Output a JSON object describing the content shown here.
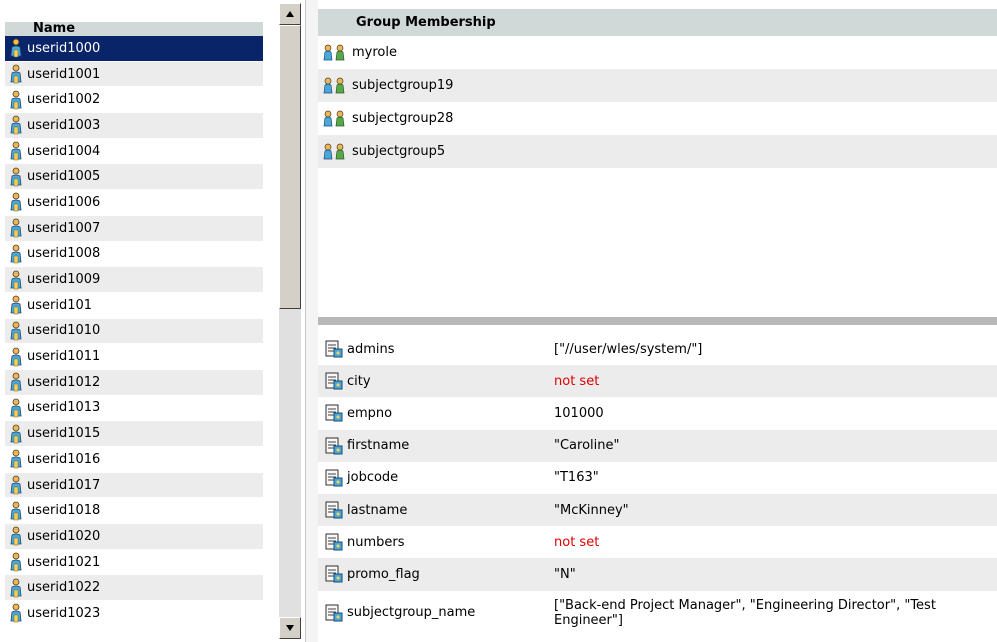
{
  "users": {
    "header": "Name",
    "items": [
      "userid1000",
      "userid1001",
      "userid1002",
      "userid1003",
      "userid1004",
      "userid1005",
      "userid1006",
      "userid1007",
      "userid1008",
      "userid1009",
      "userid101",
      "userid1010",
      "userid1011",
      "userid1012",
      "userid1013",
      "userid1015",
      "userid1016",
      "userid1017",
      "userid1018",
      "userid1020",
      "userid1021",
      "userid1022",
      "userid1023"
    ],
    "selected_index": 0
  },
  "groups": {
    "header": "Group Membership",
    "items": [
      "myrole",
      "subjectgroup19",
      "subjectgroup28",
      "subjectgroup5"
    ]
  },
  "attributes": [
    {
      "name": "admins",
      "value": "[\"//user/wles/system/\"]",
      "unset": false
    },
    {
      "name": "city",
      "value": "not set",
      "unset": true
    },
    {
      "name": "empno",
      "value": "101000",
      "unset": false
    },
    {
      "name": "firstname",
      "value": "\"Caroline\"",
      "unset": false
    },
    {
      "name": "jobcode",
      "value": "\"T163\"",
      "unset": false
    },
    {
      "name": "lastname",
      "value": "\"McKinney\"",
      "unset": false
    },
    {
      "name": "numbers",
      "value": "not set",
      "unset": true
    },
    {
      "name": "promo_flag",
      "value": "\"N\"",
      "unset": false
    },
    {
      "name": "subjectgroup_name",
      "value": "[\"Back-end Project Manager\", \"Engineering Director\", \"Test Engineer\"]",
      "unset": false
    }
  ],
  "icons": {
    "user": "user-icon",
    "group": "group-icon",
    "attribute": "attribute-icon"
  },
  "colors": {
    "selection": "#0a246a",
    "header": "#d0d8d8",
    "unset": "#e00000",
    "stripe": "#ececec"
  }
}
